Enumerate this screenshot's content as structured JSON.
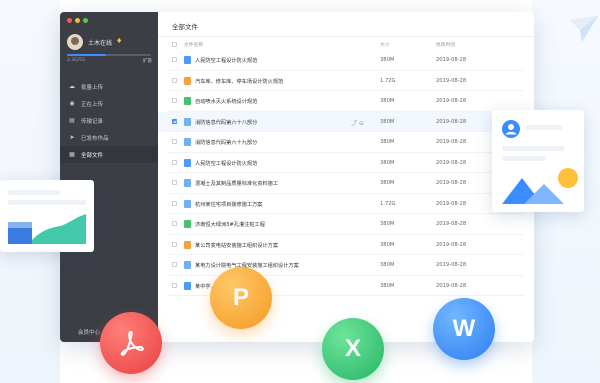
{
  "window": {
    "sidebar": {
      "username": "土木在线",
      "vip_icon": "diamond-icon",
      "storage_text": "2.3G/5G",
      "storage_used_fraction": 0.46,
      "expand_label": "扩容",
      "nav": [
        {
          "label": "批量上传",
          "icon": "upload-cloud-icon"
        },
        {
          "label": "正在上传",
          "icon": "uploading-icon"
        },
        {
          "label": "传输记录",
          "icon": "transfer-record-icon"
        },
        {
          "label": "已发布作品",
          "icon": "send-icon"
        },
        {
          "label": "全部文件",
          "icon": "grid-icon"
        }
      ],
      "member_center": "会员中心"
    },
    "main": {
      "title": "全部文件",
      "columns": {
        "name": "文件名称",
        "size": "大小",
        "date": "修改时间"
      },
      "files": [
        {
          "name": "人民防空工程设计防火规范",
          "size": "380M",
          "date": "2019-08-28",
          "type": "blue"
        },
        {
          "name": "汽车库、修车库、停车场设计防火规范",
          "size": "1.72G",
          "date": "2019-08-28",
          "type": "orange"
        },
        {
          "name": "自动喷水灭火系统设计规范",
          "size": "380M",
          "date": "2019-08-28",
          "type": "green"
        },
        {
          "name": "消防信息代码第六十八部分",
          "size": "380M",
          "date": "2019-08-28",
          "type": "lightblue"
        },
        {
          "name": "消防信息代码第六十九部分",
          "size": "380M",
          "date": "2019-08-28",
          "type": "lightblue"
        },
        {
          "name": "人民防空工程设计防火规范",
          "size": "380M",
          "date": "2019-08-28",
          "type": "blue"
        },
        {
          "name": "混凝土及其制品质量标准化资料施工",
          "size": "380M",
          "date": "2019-08-28",
          "type": "lightblue"
        },
        {
          "name": "杭州某住宅项目装修施工方案",
          "size": "1.72G",
          "date": "2019-08-28",
          "type": "lightblue"
        },
        {
          "name": "济南恒大绿洲3#孔灌注桩工程",
          "size": "380M",
          "date": "2019-08-28",
          "type": "green"
        },
        {
          "name": "某公司变电站安装施工组织设计方案",
          "size": "380M",
          "date": "2019-08-28",
          "type": "orange"
        },
        {
          "name": "某电力设计院电气工程安装施工组织设计方案",
          "size": "380M",
          "date": "2019-08-28",
          "type": "lightblue"
        },
        {
          "name": "某中学...设计",
          "size": "380M",
          "date": "2019-08-28",
          "type": "blue"
        }
      ],
      "selected_index": 3,
      "row_action_icons": [
        "share-icon",
        "more-icon"
      ]
    }
  },
  "badges": {
    "pdf_icon": "acrobat-icon",
    "ppt": "P",
    "excel": "X",
    "word": "W"
  },
  "colors": {
    "accent": "#3a8dff",
    "sidebar": "#3b3e45",
    "pdf": "#e8403e",
    "ppt": "#f59a22",
    "excel": "#25b466",
    "word": "#2d7ff3"
  }
}
